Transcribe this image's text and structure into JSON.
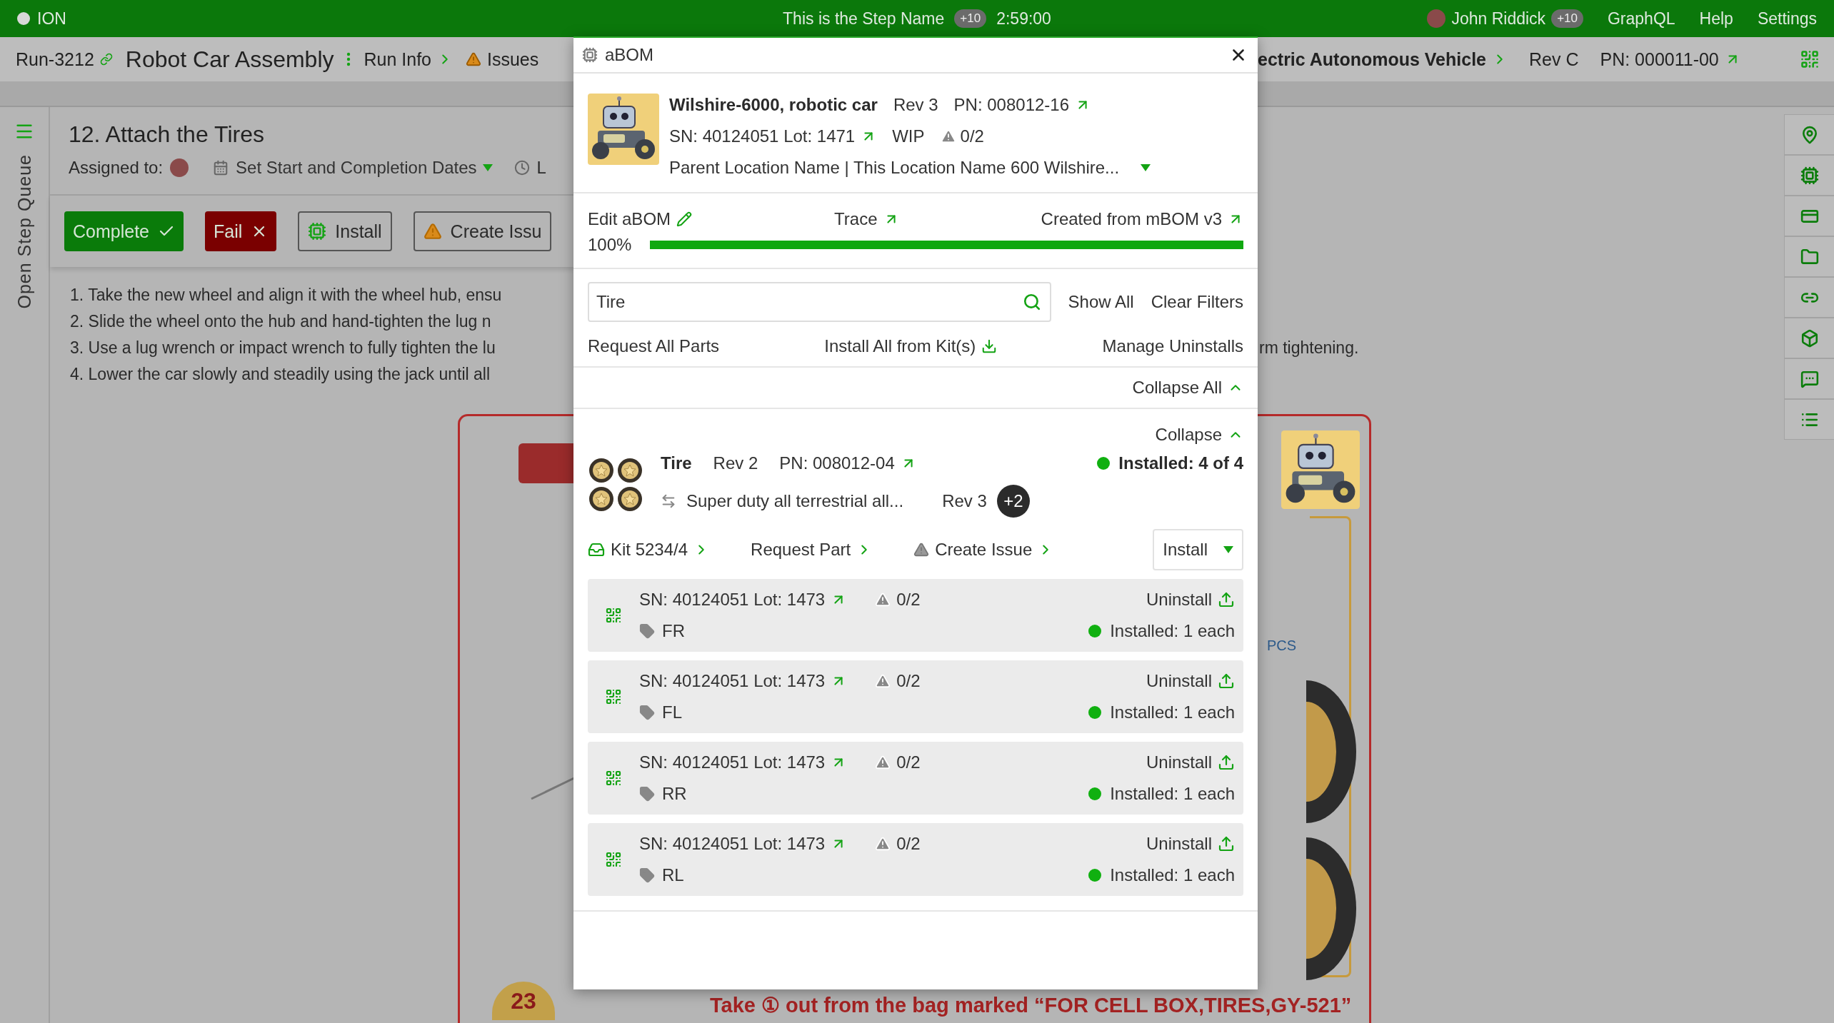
{
  "top_bar": {
    "app_name": "ION",
    "step_name": "This is the Step Name",
    "step_badge": "+10",
    "timer": "2:59:00",
    "user_name": "John Riddick",
    "user_badge": "+10",
    "links": [
      "GraphQL",
      "Help",
      "Settings"
    ]
  },
  "run_header": {
    "run_id": "Run-3212",
    "title": "Robot Car Assembly",
    "nav": [
      {
        "label": "Run Info",
        "kind": "chevron"
      },
      {
        "label": "Issues",
        "kind": "warning"
      }
    ],
    "right": [
      {
        "label": "ectric Autonomous Vehicle",
        "kind": "chevron"
      },
      {
        "label": "Rev C",
        "kind": "plain"
      },
      {
        "label": "PN: 000011-00",
        "kind": "external"
      }
    ]
  },
  "step_queue": {
    "label": "Open Step Queue"
  },
  "step": {
    "title": "12. Attach the Tires",
    "assigned_label": "Assigned to:",
    "dates_label": "Set Start and Completion Dates",
    "time_label": "L",
    "actions": [
      {
        "label": "Complete",
        "kind": "complete"
      },
      {
        "label": "Fail",
        "kind": "fail"
      },
      {
        "label": "Install",
        "kind": "install"
      },
      {
        "label": "Create Issu",
        "kind": "issue"
      }
    ],
    "instructions": [
      {
        "visible_start": "1. Take the new wheel and align it with the wheel hub, ensu"
      },
      {
        "visible_start": "2. Slide the wheel onto the hub and hand-tighten the lug n"
      },
      {
        "visible_start": "3. Use a lug wrench or impact wrench to fully tighten the lu",
        "visible_end": "rm tightening."
      },
      {
        "visible_start": "4. Lower the car slowly and steadily using the jack until all"
      }
    ],
    "figure": {
      "step_number": "23",
      "caption": "Take ① out from the bag marked “FOR CELL BOX,TIRES,GY-521”",
      "unit_label": "PCS"
    }
  },
  "abom_dialog": {
    "title": "aBOM",
    "item": {
      "name": "Wilshire-6000, robotic car",
      "rev": "Rev 3",
      "pn": "PN: 008012-16",
      "serial": "SN: 40124051 Lot: 1471",
      "status": "WIP",
      "issues": "0/2",
      "location": "Parent Location Name | This Location Name 600 Wilshire..."
    },
    "links": [
      {
        "label": "Edit aBOM",
        "kind": "edit"
      },
      {
        "label": "Trace",
        "kind": "external"
      },
      {
        "label": "Created from mBOM v3",
        "kind": "external"
      }
    ],
    "progress": {
      "reading": "100%",
      "level": 1
    },
    "search": {
      "value": "Tire"
    },
    "filter_actions": [
      "Show All",
      "Clear Filters"
    ],
    "bulk_actions": [
      {
        "label": "Request All Parts",
        "kind": "plain"
      },
      {
        "label": "Install All from Kit(s)",
        "kind": "download"
      },
      {
        "label": "Manage Uninstalls",
        "kind": "plain"
      }
    ],
    "collapse_all": "Collapse All",
    "parts": [
      {
        "collapse": "Collapse",
        "expanded": true,
        "name": "Tire",
        "rev": "Rev 2",
        "pn": "PN: 008012-04",
        "installed": "Installed: 4 of 4",
        "alternate": "Super duty all terrestrial all...",
        "alternate_rev": "Rev 3",
        "alternate_count": "+2",
        "actions": [
          {
            "label": "Kit 5234/4",
            "kind": "kit"
          },
          {
            "label": "Request Part",
            "kind": "plain"
          },
          {
            "label": "Create Issue",
            "kind": "issue"
          }
        ],
        "install_button": "Install",
        "instances": [
          {
            "serial": "SN: 40124051 Lot: 1473",
            "issues": "0/2",
            "position": "FR",
            "action": "Uninstall",
            "installed": "Installed: 1 each"
          },
          {
            "serial": "SN: 40124051 Lot: 1473",
            "issues": "0/2",
            "position": "FL",
            "action": "Uninstall",
            "installed": "Installed: 1 each"
          },
          {
            "serial": "SN: 40124051 Lot: 1473",
            "issues": "0/2",
            "position": "RR",
            "action": "Uninstall",
            "installed": "Installed: 1 each"
          },
          {
            "serial": "SN: 40124051 Lot: 1473",
            "issues": "0/2",
            "position": "RL",
            "action": "Uninstall",
            "installed": "Installed: 1 each"
          }
        ]
      }
    ]
  }
}
